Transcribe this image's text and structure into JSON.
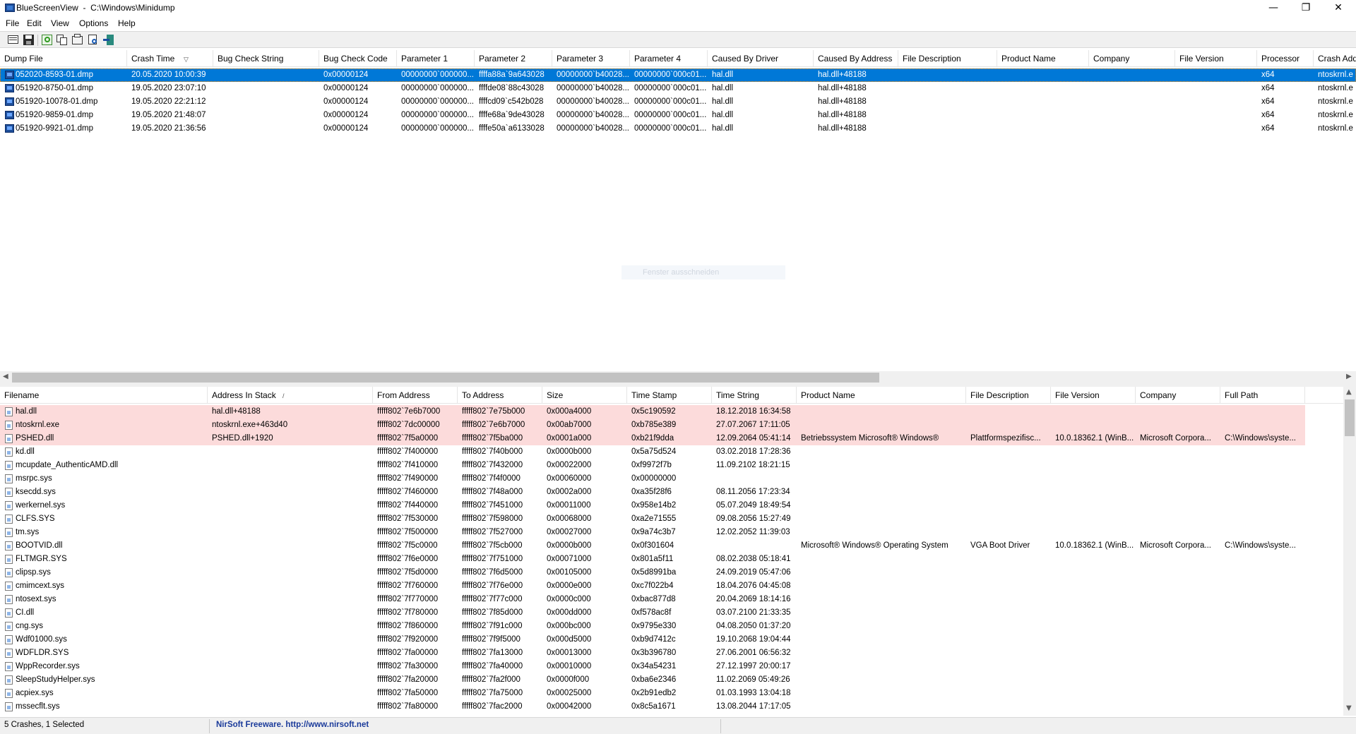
{
  "window": {
    "title": "BlueScreenView  -  C:\\Windows\\Minidump",
    "controls": {
      "minimize": "—",
      "restore": "❐",
      "close": "✕"
    }
  },
  "menu": [
    "File",
    "Edit",
    "View",
    "Options",
    "Help"
  ],
  "toolbar": {
    "icons": [
      "properties-icon",
      "save-icon",
      "refresh-icon",
      "copy-icon",
      "html-report-icon",
      "find-icon",
      "exit-icon"
    ]
  },
  "crashes": {
    "columns": [
      "Dump File",
      "Crash Time",
      "Bug Check String",
      "Bug Check Code",
      "Parameter 1",
      "Parameter 2",
      "Parameter 3",
      "Parameter 4",
      "Caused By Driver",
      "Caused By Address",
      "File Description",
      "Product Name",
      "Company",
      "File Version",
      "Processor",
      "Crash Add"
    ],
    "sort_indicator": "▽",
    "rows": [
      [
        "052020-8593-01.dmp",
        "20.05.2020 10:00:39",
        "",
        "0x00000124",
        "00000000`000000...",
        "ffffa88a`9a643028",
        "00000000`b40028...",
        "00000000`000c01...",
        "hal.dll",
        "hal.dll+48188",
        "",
        "",
        "",
        "",
        "x64",
        "ntoskrnl.e"
      ],
      [
        "051920-8750-01.dmp",
        "19.05.2020 23:07:10",
        "",
        "0x00000124",
        "00000000`000000...",
        "ffffde08`88c43028",
        "00000000`b40028...",
        "00000000`000c01...",
        "hal.dll",
        "hal.dll+48188",
        "",
        "",
        "",
        "",
        "x64",
        "ntoskrnl.e"
      ],
      [
        "051920-10078-01.dmp",
        "19.05.2020 22:21:12",
        "",
        "0x00000124",
        "00000000`000000...",
        "ffffcd09`c542b028",
        "00000000`b40028...",
        "00000000`000c01...",
        "hal.dll",
        "hal.dll+48188",
        "",
        "",
        "",
        "",
        "x64",
        "ntoskrnl.e"
      ],
      [
        "051920-9859-01.dmp",
        "19.05.2020 21:48:07",
        "",
        "0x00000124",
        "00000000`000000...",
        "ffffe68a`9de43028",
        "00000000`b40028...",
        "00000000`000c01...",
        "hal.dll",
        "hal.dll+48188",
        "",
        "",
        "",
        "",
        "x64",
        "ntoskrnl.e"
      ],
      [
        "051920-9921-01.dmp",
        "19.05.2020 21:36:56",
        "",
        "0x00000124",
        "00000000`000000...",
        "ffffe50a`a6133028",
        "00000000`b40028...",
        "00000000`000c01...",
        "hal.dll",
        "hal.dll+48188",
        "",
        "",
        "",
        "",
        "x64",
        "ntoskrnl.e"
      ]
    ],
    "selected_index": 0
  },
  "ghost_text": "Fenster ausschneiden",
  "drivers": {
    "columns": [
      "Filename",
      "Address In Stack",
      "From Address",
      "To Address",
      "Size",
      "Time Stamp",
      "Time String",
      "Product Name",
      "File Description",
      "File Version",
      "Company",
      "Full Path"
    ],
    "sort_indicator": "/",
    "highlighted_count": 3,
    "rows": [
      [
        "hal.dll",
        "hal.dll+48188",
        "fffff802`7e6b7000",
        "fffff802`7e75b000",
        "0x000a4000",
        "0x5c190592",
        "18.12.2018 16:34:58",
        "",
        "",
        "",
        "",
        ""
      ],
      [
        "ntoskrnl.exe",
        "ntoskrnl.exe+463d40",
        "fffff802`7dc00000",
        "fffff802`7e6b7000",
        "0x00ab7000",
        "0xb785e389",
        "27.07.2067 17:11:05",
        "",
        "",
        "",
        "",
        ""
      ],
      [
        "PSHED.dll",
        "PSHED.dll+1920",
        "fffff802`7f5a0000",
        "fffff802`7f5ba000",
        "0x0001a000",
        "0xb21f9dda",
        "12.09.2064 05:41:14",
        "Betriebssystem Microsoft® Windows®",
        "Plattformspezifisc...",
        "10.0.18362.1 (WinB...",
        "Microsoft Corpora...",
        "C:\\Windows\\syste..."
      ],
      [
        "kd.dll",
        "",
        "fffff802`7f400000",
        "fffff802`7f40b000",
        "0x0000b000",
        "0x5a75d524",
        "03.02.2018 17:28:36",
        "",
        "",
        "",
        "",
        ""
      ],
      [
        "mcupdate_AuthenticAMD.dll",
        "",
        "fffff802`7f410000",
        "fffff802`7f432000",
        "0x00022000",
        "0xf9972f7b",
        "11.09.2102 18:21:15",
        "",
        "",
        "",
        "",
        ""
      ],
      [
        "msrpc.sys",
        "",
        "fffff802`7f490000",
        "fffff802`7f4f0000",
        "0x00060000",
        "0x00000000",
        "",
        "",
        "",
        "",
        "",
        ""
      ],
      [
        "ksecdd.sys",
        "",
        "fffff802`7f460000",
        "fffff802`7f48a000",
        "0x0002a000",
        "0xa35f28f6",
        "08.11.2056 17:23:34",
        "",
        "",
        "",
        "",
        ""
      ],
      [
        "werkernel.sys",
        "",
        "fffff802`7f440000",
        "fffff802`7f451000",
        "0x00011000",
        "0x958e14b2",
        "05.07.2049 18:49:54",
        "",
        "",
        "",
        "",
        ""
      ],
      [
        "CLFS.SYS",
        "",
        "fffff802`7f530000",
        "fffff802`7f598000",
        "0x00068000",
        "0xa2e71555",
        "09.08.2056 15:27:49",
        "",
        "",
        "",
        "",
        ""
      ],
      [
        "tm.sys",
        "",
        "fffff802`7f500000",
        "fffff802`7f527000",
        "0x00027000",
        "0x9a74c3b7",
        "12.02.2052 11:39:03",
        "",
        "",
        "",
        "",
        ""
      ],
      [
        "BOOTVID.dll",
        "",
        "fffff802`7f5c0000",
        "fffff802`7f5cb000",
        "0x0000b000",
        "0x0f301604",
        "",
        "Microsoft® Windows® Operating System",
        "VGA Boot Driver",
        "10.0.18362.1 (WinB...",
        "Microsoft Corpora...",
        "C:\\Windows\\syste..."
      ],
      [
        "FLTMGR.SYS",
        "",
        "fffff802`7f6e0000",
        "fffff802`7f751000",
        "0x00071000",
        "0x801a5f11",
        "08.02.2038 05:18:41",
        "",
        "",
        "",
        "",
        ""
      ],
      [
        "clipsp.sys",
        "",
        "fffff802`7f5d0000",
        "fffff802`7f6d5000",
        "0x00105000",
        "0x5d8991ba",
        "24.09.2019 05:47:06",
        "",
        "",
        "",
        "",
        ""
      ],
      [
        "cmimcext.sys",
        "",
        "fffff802`7f760000",
        "fffff802`7f76e000",
        "0x0000e000",
        "0xc7f022b4",
        "18.04.2076 04:45:08",
        "",
        "",
        "",
        "",
        ""
      ],
      [
        "ntosext.sys",
        "",
        "fffff802`7f770000",
        "fffff802`7f77c000",
        "0x0000c000",
        "0xbac877d8",
        "20.04.2069 18:14:16",
        "",
        "",
        "",
        "",
        ""
      ],
      [
        "CI.dll",
        "",
        "fffff802`7f780000",
        "fffff802`7f85d000",
        "0x000dd000",
        "0xf578ac8f",
        "03.07.2100 21:33:35",
        "",
        "",
        "",
        "",
        ""
      ],
      [
        "cng.sys",
        "",
        "fffff802`7f860000",
        "fffff802`7f91c000",
        "0x000bc000",
        "0x9795e330",
        "04.08.2050 01:37:20",
        "",
        "",
        "",
        "",
        ""
      ],
      [
        "Wdf01000.sys",
        "",
        "fffff802`7f920000",
        "fffff802`7f9f5000",
        "0x000d5000",
        "0xb9d7412c",
        "19.10.2068 19:04:44",
        "",
        "",
        "",
        "",
        ""
      ],
      [
        "WDFLDR.SYS",
        "",
        "fffff802`7fa00000",
        "fffff802`7fa13000",
        "0x00013000",
        "0x3b396780",
        "27.06.2001 06:56:32",
        "",
        "",
        "",
        "",
        ""
      ],
      [
        "WppRecorder.sys",
        "",
        "fffff802`7fa30000",
        "fffff802`7fa40000",
        "0x00010000",
        "0x34a54231",
        "27.12.1997 20:00:17",
        "",
        "",
        "",
        "",
        ""
      ],
      [
        "SleepStudyHelper.sys",
        "",
        "fffff802`7fa20000",
        "fffff802`7fa2f000",
        "0x0000f000",
        "0xba6e2346",
        "11.02.2069 05:49:26",
        "",
        "",
        "",
        "",
        ""
      ],
      [
        "acpiex.sys",
        "",
        "fffff802`7fa50000",
        "fffff802`7fa75000",
        "0x00025000",
        "0x2b91edb2",
        "01.03.1993 13:04:18",
        "",
        "",
        "",
        "",
        ""
      ],
      [
        "mssecflt.sys",
        "",
        "fffff802`7fa80000",
        "fffff802`7fac2000",
        "0x00042000",
        "0x8c5a1671",
        "13.08.2044 17:17:05",
        "",
        "",
        "",
        "",
        ""
      ]
    ]
  },
  "status": {
    "count": "5 Crashes, 1 Selected",
    "credit": "NirSoft Freeware.  http://www.nirsoft.net"
  },
  "colors": {
    "selection": "#0078d7",
    "highlight_row": "#fcdbdb",
    "link": "#1a3a9a"
  }
}
